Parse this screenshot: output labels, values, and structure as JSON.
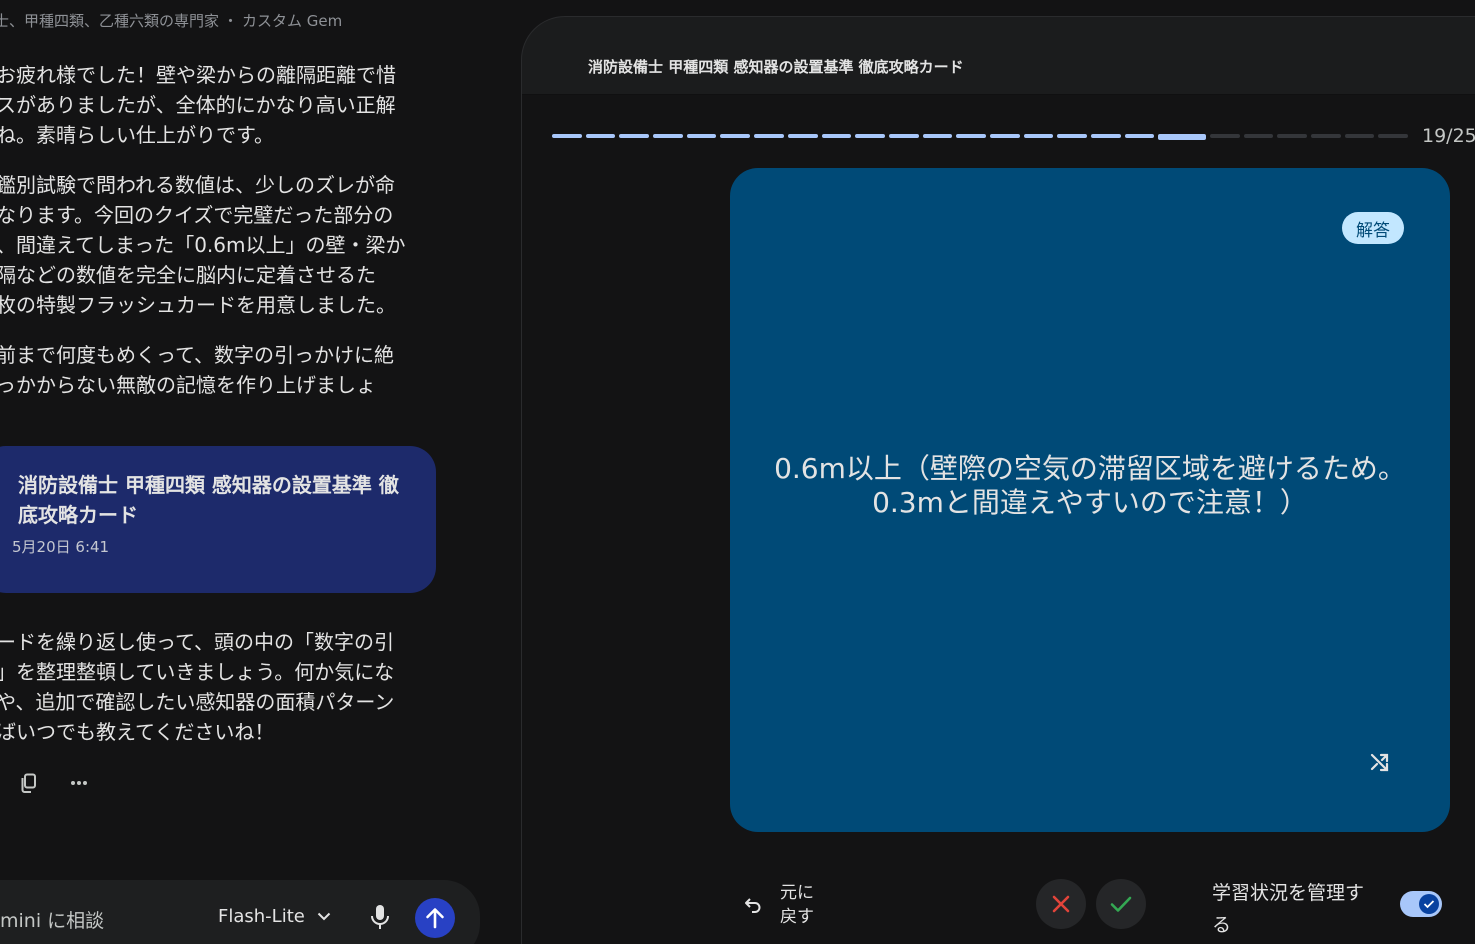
{
  "chat": {
    "gem_header": {
      "name": "士、甲種四類、乙種六類の専門家",
      "separator": "・",
      "type": "カスタム Gem"
    },
    "paragraphs": [
      "お疲れ様でした！壁や梁からの離隔距離で惜\nスがありましたが、全体的にかなり高い正解\nね。素晴らしい仕上がりです。",
      "鑑別試験で問われる数値は、少しのズレが命\nなります。今回のクイズで完璧だった部分の\n、間違えてしまった「0.6m以上」の壁・梁か\n隔などの数値を完全に脳内に定着させるた\n枚の特製フラッシュカードを用意しました。",
      "前まで何度もめくって、数字の引っかけに絶\nっかからない無敵の記憶を作り上げましょ",
      "ードを繰り返し使って、頭の中の「数字の引\n」を整理整頓していきましょう。何か気にな\nや、追加で確認したい感知器の面積パターン\nばいつでも教えてくださいね！"
    ],
    "flashcard_chip": {
      "title": "消防設備士 甲種四類 感知器の設置基準 徹底攻略カード",
      "date": "5月20日 6:41"
    },
    "composer": {
      "placeholder": "mini に相談",
      "model": "Flash-Lite"
    }
  },
  "canvas": {
    "title": "消防設備士 甲種四類 感知器の設置基準 徹底攻略カード",
    "progress": {
      "current": 19,
      "total": 25,
      "label": "19/25"
    },
    "card": {
      "badge": "解答",
      "text": "0.6m以上（壁際の空気の滞留区域を避けるため。0.3mと間違えやすいので注意！）"
    },
    "controls": {
      "undo_label": "元に戻す",
      "tracking_label": "学習状況を管理する",
      "tracking_enabled": true
    }
  },
  "colors": {
    "background": "#131314",
    "card": "#004a77",
    "chip": "#1d2a6b",
    "accent": "#a8c7fa",
    "wrong": "#e2443a",
    "right": "#34a853",
    "send": "#2841c4"
  },
  "icons": [
    "copy-icon",
    "more-icon",
    "chevron-down-icon",
    "mic-icon",
    "arrow-up-icon",
    "shuffle-icon",
    "undo-icon",
    "close-icon",
    "check-icon"
  ]
}
